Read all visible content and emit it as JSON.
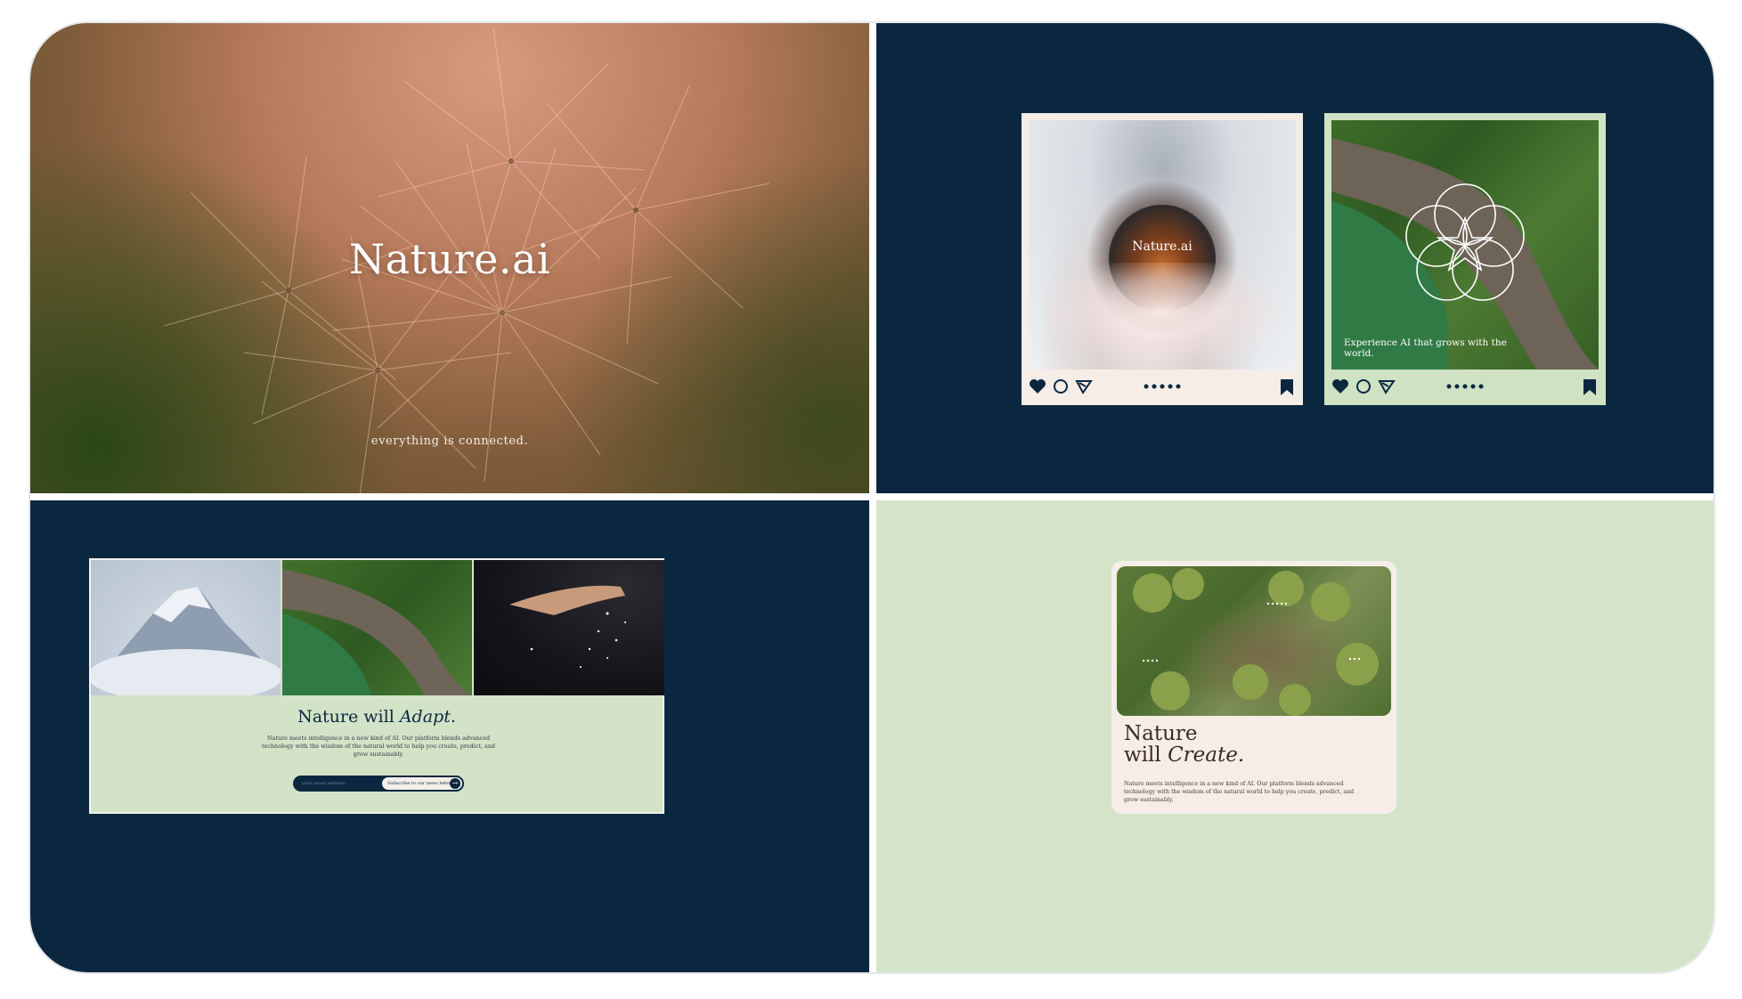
{
  "hero": {
    "title": "Nature.ai",
    "tagline": "everything is connected."
  },
  "social": {
    "posts": [
      {
        "brand": "Nature.ai",
        "caption": ""
      },
      {
        "brand": "",
        "caption": "Experience AI that grows with the world."
      }
    ],
    "actions": [
      "heart-icon",
      "comment-icon",
      "share-icon",
      "more-icon",
      "bookmark-icon"
    ]
  },
  "newsletter": {
    "title_prefix": "Nature will",
    "title_italic": "Adapt.",
    "body": "Nature meets intelligence in a new kind of AI. Our platform blends advanced technology with the wisdom of the natural world to help you create, predict, and grow sustainably.",
    "input_placeholder": "your email address",
    "button_label": "Subscribe to our news letter"
  },
  "card": {
    "title_line1": "Nature",
    "title_prefix": "will",
    "title_italic": "Create.",
    "body": "Nature meets intelligence in a new kind of AI. Our platform blends advanced technology with the wisdom of the natural world to help you create, predict, and grow sustainably."
  },
  "colors": {
    "navy": "#0b2740",
    "sage": "#d5e4c9",
    "cream": "#f6ede7"
  }
}
